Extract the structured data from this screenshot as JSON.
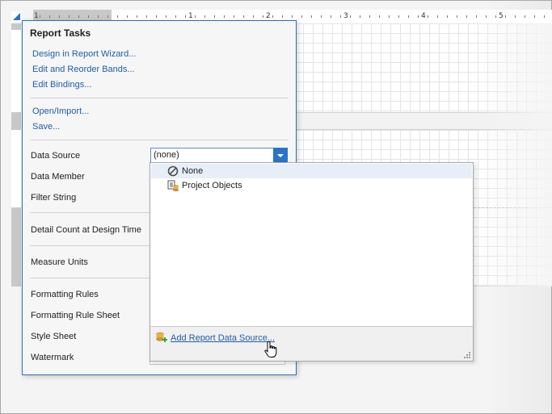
{
  "ruler": {
    "numbers": [
      "1",
      "1",
      "2",
      "3",
      "4",
      "5"
    ]
  },
  "panel": {
    "title": "Report Tasks",
    "links": {
      "design_wizard": "Design in Report Wizard...",
      "edit_bands": "Edit and Reorder Bands...",
      "edit_bindings": "Edit Bindings...",
      "open_import": "Open/Import...",
      "save": "Save..."
    },
    "properties": {
      "data_source": "Data Source",
      "data_member": "Data Member",
      "filter_string": "Filter String",
      "detail_count": "Detail Count at Design Time",
      "measure_units": "Measure Units",
      "formatting_rules": "Formatting Rules",
      "formatting_rule_sheet": "Formatting Rule Sheet",
      "style_sheet": "Style Sheet",
      "watermark": "Watermark"
    },
    "data_source_value": "(none)"
  },
  "dropdown": {
    "items": [
      {
        "label": "None",
        "icon": "none-icon",
        "selected": true
      },
      {
        "label": "Project Objects",
        "icon": "project-objects-icon",
        "selected": false
      }
    ],
    "footer_link": "Add Report Data Source..."
  },
  "colors": {
    "accent": "#2a73c9",
    "link": "#1f5cab",
    "panel_border": "#2f6eb7",
    "selection": "#e7eef8"
  }
}
